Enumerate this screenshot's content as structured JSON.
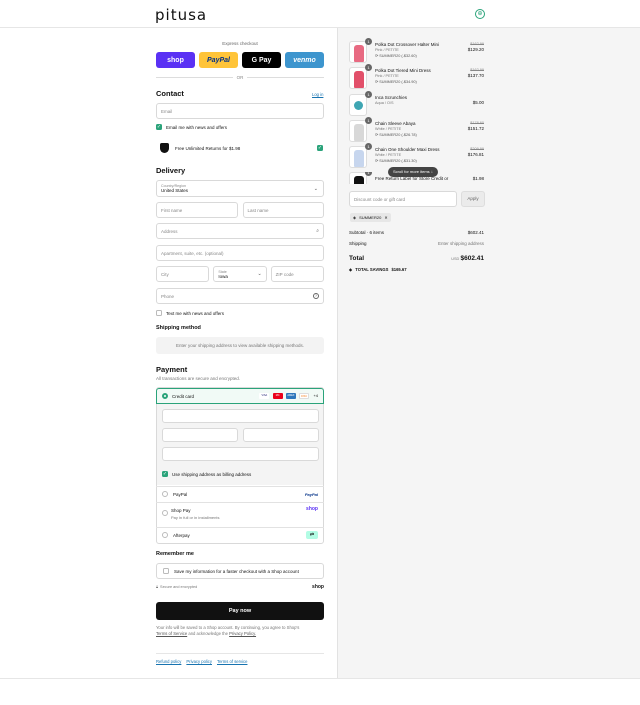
{
  "header": {
    "logo": "pitusa",
    "cart_icon": "bag-icon",
    "cart_glyph": "⊕"
  },
  "express": {
    "title": "Express checkout",
    "buttons": [
      {
        "label": "shop",
        "color": "#5a31f4",
        "text_color": "#ffffff"
      },
      {
        "label": "PayPal",
        "color": "#ffc439",
        "text_color": "#003087"
      },
      {
        "label": "G Pay",
        "color": "#000000",
        "text_color": "#ffffff"
      },
      {
        "label": "venmo",
        "color": "#3d95ce",
        "text_color": "#ffffff"
      }
    ],
    "or_label": "OR"
  },
  "contact": {
    "title": "Contact",
    "login_link": "Log in",
    "email_placeholder": "Email",
    "email_news_label": "Email me with news and offers",
    "returns_label": "Free Unlimited Returns for $1.98"
  },
  "delivery": {
    "title": "Delivery",
    "country_label": "Country/Region",
    "country_value": "United States",
    "first_name": "First name",
    "last_name": "Last name",
    "address": "Address",
    "apartment": "Apartment, suite, etc. (optional)",
    "city": "City",
    "state_label": "State",
    "state_value": "Iowa",
    "zip": "ZIP code",
    "phone": "Phone",
    "text_news_label": "Text me with news and offers"
  },
  "shipping_method": {
    "title": "Shipping method",
    "message": "Enter your shipping address to view available shipping methods."
  },
  "payment": {
    "title": "Payment",
    "subtitle": "All transactions are secure and encrypted.",
    "credit_card_label": "Credit card",
    "card_brands": [
      "VISA",
      "MC",
      "AMEX",
      "DISC"
    ],
    "more_cards": "+4",
    "billing_label": "Use shipping address as billing address",
    "paypal_label": "PayPal",
    "paypal_logo": "PayPal",
    "shoppay_label": "Shop Pay",
    "shoppay_sub": "Pay in full or in installments",
    "shoppay_logo": "shop",
    "afterpay_label": "Afterpay"
  },
  "remember": {
    "title": "Remember me",
    "save_label": "Save my information for a faster checkout with a Shop account",
    "secure_label": "Secure and encrypted",
    "shop_logo": "shop"
  },
  "pay_now_label": "Pay now",
  "legal": {
    "text": "Your info will be saved to a Shop account. By continuing, you agree to Shop's",
    "terms_link": "Terms of Service",
    "and_text": "and acknowledge the",
    "privacy_link": "Privacy Policy."
  },
  "footer_links": [
    "Refund policy",
    "Privacy policy",
    "Terms of service"
  ],
  "cart": {
    "items": [
      {
        "name": "Polka Dot Crossover Halter Mini",
        "variant": "Pink / PETITE",
        "discount": "SUMMER20 (-$32.60)",
        "old_price": "$162.99",
        "price": "$129.20",
        "qty": "1",
        "color": "#e86a82"
      },
      {
        "name": "Polka Dot Tiered Mini Dress",
        "variant": "Pink / PETITE",
        "discount": "SUMMER20 (-$34.90)",
        "old_price": "$162.99",
        "price": "$137.70",
        "qty": "1",
        "color": "#e2506a"
      },
      {
        "name": "Inca Scrunchies",
        "variant": "Aqua / O/S",
        "discount": "",
        "old_price": "",
        "price": "$5.00",
        "qty": "1",
        "color": "#3fa6b3"
      },
      {
        "name": "Chain Sleeve Abaya",
        "variant": "White / PETITE",
        "discount": "SUMMER20 (-$26.78)",
        "old_price": "$178.60",
        "price": "$151.72",
        "qty": "1",
        "color": "#d8d8d8"
      },
      {
        "name": "Chain One Shoulder Maxi Dress",
        "variant": "White / PETITE",
        "discount": "SUMMER20 (-$31.30)",
        "old_price": "$209.99",
        "price": "$176.81",
        "qty": "1",
        "color": "#c7d6ee"
      },
      {
        "name": "Free Return Label for Store Credit or",
        "variant": "",
        "discount": "",
        "old_price": "",
        "price": "$1.98",
        "qty": "1",
        "color": "#111111"
      }
    ],
    "scroll_hint": "Scroll for more items",
    "discount_placeholder": "Discount code or gift card",
    "apply_label": "Apply",
    "applied_code": "SUMMER20",
    "subtotal_label": "Subtotal · 6 items",
    "subtotal_value": "$602.41",
    "shipping_label": "Shipping",
    "shipping_value": "Enter shipping address",
    "total_label": "Total",
    "currency": "USD",
    "total_value": "$602.41",
    "savings_label": "TOTAL SAVINGS",
    "savings_value": "$165.67"
  }
}
